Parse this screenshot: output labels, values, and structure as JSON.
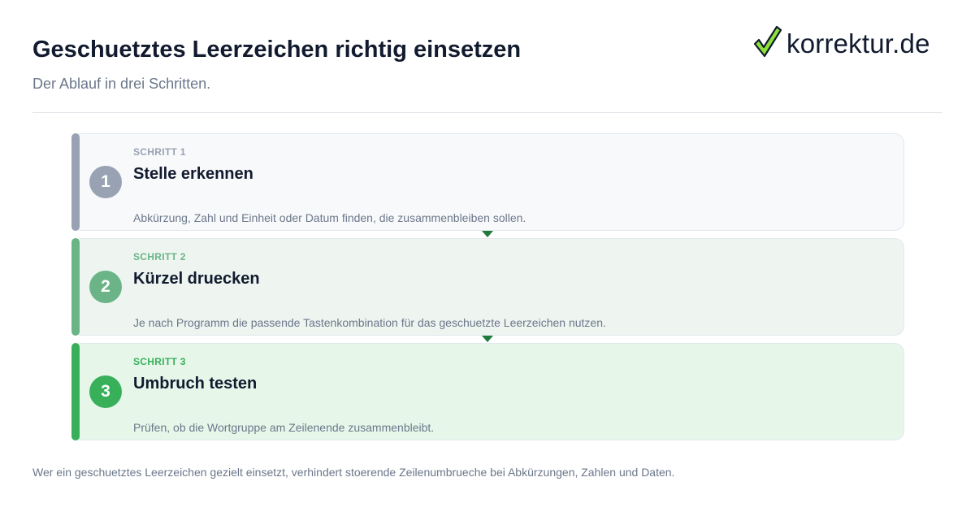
{
  "header": {
    "title": "Geschuetztes Leerzeichen richtig einsetzen",
    "subtitle": "Der Ablauf in drei Schritten."
  },
  "logo": {
    "text": "korrektur.de",
    "icon": "checkmark-icon",
    "colors": {
      "check_fill": "#8ee03a",
      "check_outline": "#111a2e"
    }
  },
  "steps": [
    {
      "number": "1",
      "label": "SCHRITT 1",
      "title": "Stelle erkennen",
      "description": "Abkürzung, Zahl und Einheit oder Datum finden, die zusammenbleiben sollen.",
      "color": "#98a2b3"
    },
    {
      "number": "2",
      "label": "SCHRITT 2",
      "title": "Kürzel druecken",
      "description": "Je nach Programm die passende Tastenkombination für das geschuetzte Leerzeichen nutzen.",
      "color": "#6ab487"
    },
    {
      "number": "3",
      "label": "SCHRITT 3",
      "title": "Umbruch testen",
      "description": "Prüfen, ob die Wortgruppe am Zeilenende zusammenbleibt.",
      "color": "#38b05a"
    }
  ],
  "connector_color": "#1f7a3c",
  "footer": {
    "text": "Wer ein geschuetztes Leerzeichen gezielt einsetzt, verhindert stoerende Zeilenumbrueche bei Abkürzungen, Zahlen und Daten."
  }
}
